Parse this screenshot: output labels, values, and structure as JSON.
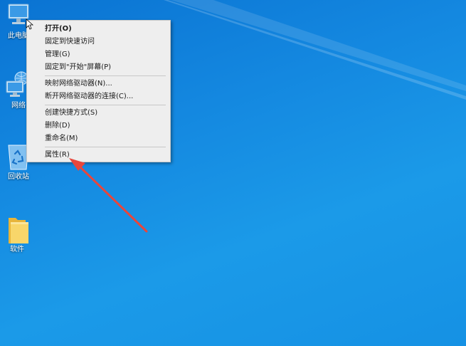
{
  "desktop": {
    "background": "#1488e0",
    "icons": [
      {
        "label": "此电脑",
        "icon": "computer-icon"
      },
      {
        "label": "网络",
        "icon": "network-icon"
      },
      {
        "label": "回收站",
        "icon": "recycle-bin-icon"
      },
      {
        "label": "软件",
        "icon": "folder-icon"
      }
    ]
  },
  "context_menu": {
    "items": [
      {
        "label": "打开(O)"
      },
      {
        "label": "固定到快速访问"
      },
      {
        "label": "管理(G)"
      },
      {
        "label": "固定到\"开始\"屏幕(P)"
      },
      {
        "label": "映射网络驱动器(N)..."
      },
      {
        "label": "断开网络驱动器的连接(C)..."
      },
      {
        "label": "创建快捷方式(S)"
      },
      {
        "label": "删除(D)"
      },
      {
        "label": "重命名(M)"
      },
      {
        "label": "属性(R)"
      }
    ]
  },
  "annotation": {
    "color": "#e8463c"
  }
}
